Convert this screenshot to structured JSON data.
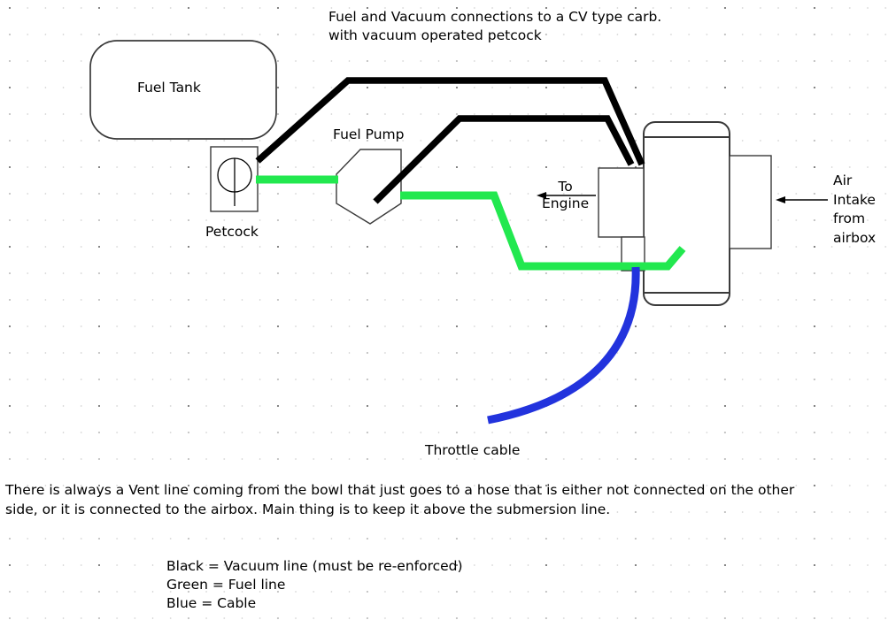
{
  "diagram": {
    "title": "Fuel and Vacuum connections to a CV type carb.\nwith vacuum operated petcock",
    "labels": {
      "fuel_tank": "Fuel Tank",
      "petcock": "Petcock",
      "fuel_pump": "Fuel Pump",
      "to_engine": "To\nEngine",
      "air_intake": "Air\nIntake\nfrom\nairbox",
      "throttle_cable": "Throttle cable"
    },
    "note": "There is always a Vent line coming from the bowl that just goes to a hose that is either not connected on the other\nside, or it is connected to the airbox.  Main thing is to keep it above the submersion line.",
    "legend": "Black = Vacuum line (must be re-enforced)\nGreen = Fuel line\nBlue  =  Cable"
  },
  "colors": {
    "vacuum_line": "#000000",
    "fuel_line": "#22e84f",
    "cable": "#2233dd",
    "outline": "#3a3a3a",
    "background": "#ffffff",
    "text": "#000000"
  }
}
